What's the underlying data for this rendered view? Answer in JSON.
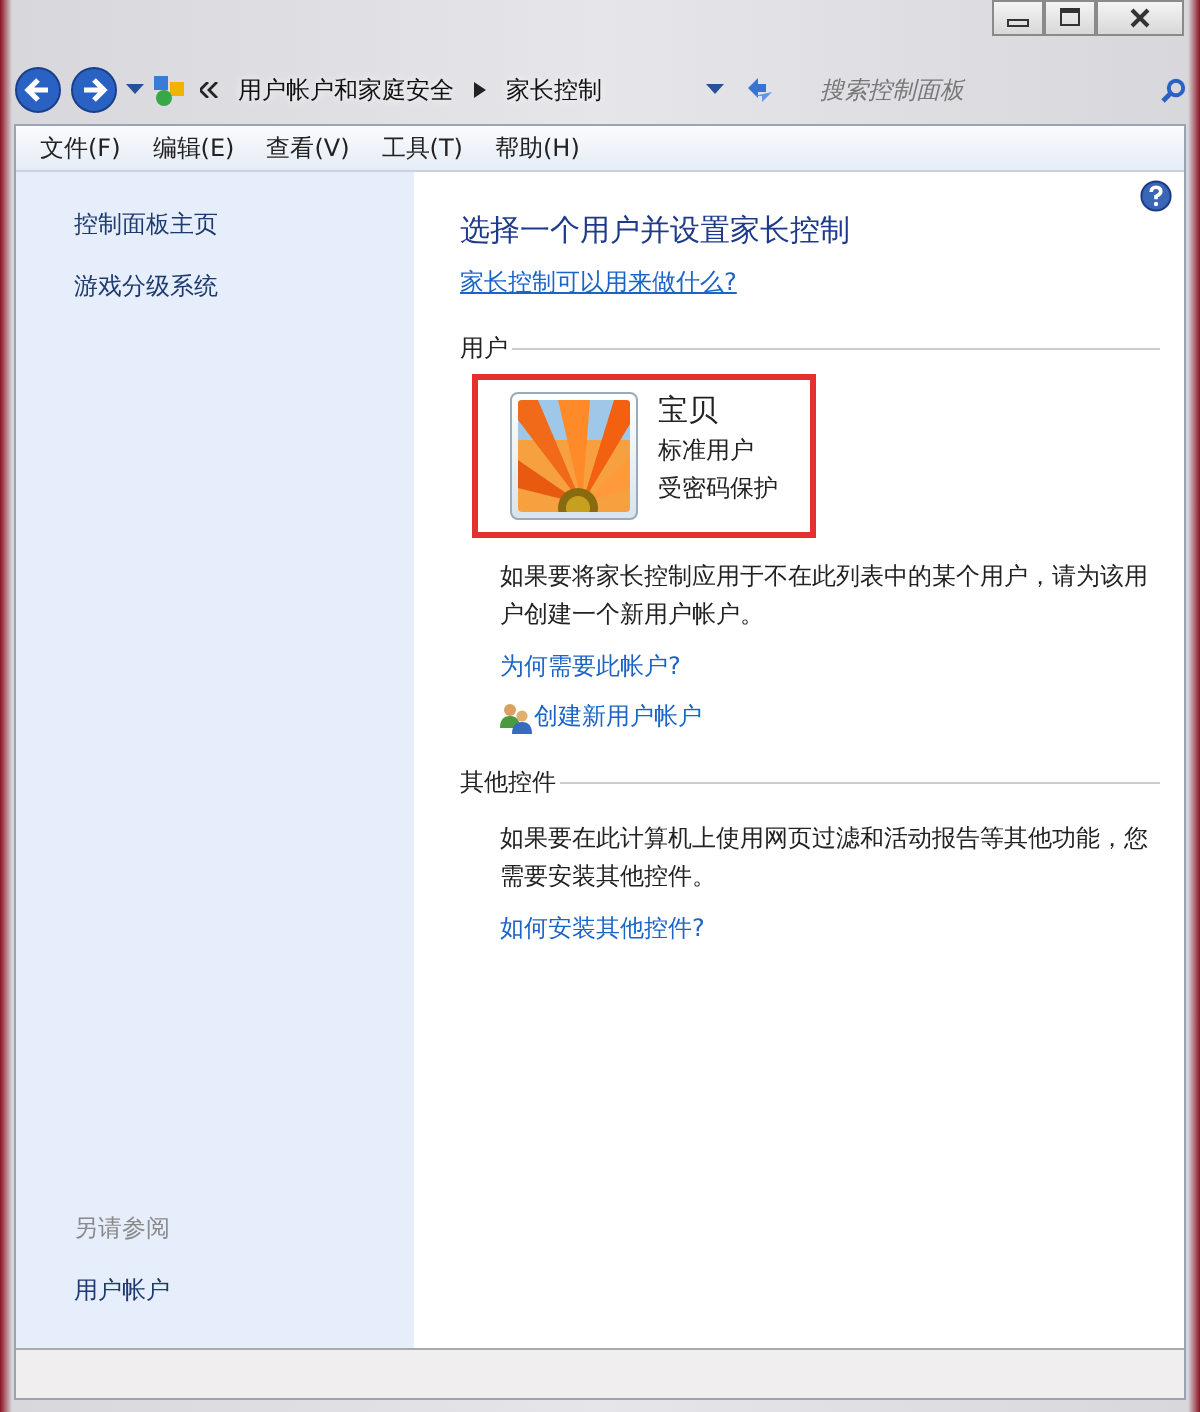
{
  "address_bar": {
    "breadcrumbs": [
      "用户帐户和家庭安全",
      "家长控制"
    ],
    "search": {
      "placeholder": "搜索控制面板"
    }
  },
  "menu_bar": [
    "文件(F)",
    "编辑(E)",
    "查看(V)",
    "工具(T)",
    "帮助(H)"
  ],
  "sidebar": {
    "items": [
      "控制面板主页",
      "游戏分级系统"
    ],
    "see_also_heading": "另请参阅",
    "see_also": [
      "用户帐户"
    ]
  },
  "main": {
    "title": "选择一个用户并设置家长控制",
    "help_link": "家长控制可以用来做什么?",
    "users_section": {
      "heading": "用户",
      "users": [
        {
          "name": "宝贝",
          "type": "标准用户",
          "status": "受密码保护",
          "highlighted": true
        }
      ],
      "note": "如果要将家长控制应用于不在此列表中的某个用户，请为该用户创建一个新用户帐户。",
      "why_link": "为何需要此帐户?",
      "create_link": "创建新用户帐户"
    },
    "other_section": {
      "heading": "其他控件",
      "note": "如果要在此计算机上使用网页过滤和活动报告等其他功能，您需要安装其他控件。",
      "install_link": "如何安装其他控件?"
    }
  }
}
